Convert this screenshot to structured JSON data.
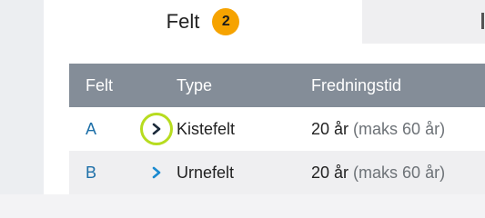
{
  "tabs": [
    {
      "label": "Felt",
      "badge": "2",
      "active": true
    },
    {
      "label": "",
      "active": false
    }
  ],
  "table": {
    "headers": {
      "felt": "Felt",
      "type": "Type",
      "fredningstid": "Fredningstid"
    },
    "rows": [
      {
        "felt": "A",
        "type": "Kistefelt",
        "fredningstid": "20 år",
        "maks": "(maks 60 år)",
        "chevron_icon": "chevron-right-icon",
        "chevron_color": "#1b2a3a",
        "focused": true
      },
      {
        "felt": "B",
        "type": "Urnefelt",
        "fredningstid": "20 år",
        "maks": "(maks 60 år)",
        "chevron_icon": "chevron-right-icon",
        "chevron_color": "#1a8ad0",
        "focused": false
      }
    ]
  },
  "colors": {
    "badge": "#f6a300",
    "header_bg": "#848d98",
    "focus_ring": "#b7dc1f",
    "link": "#1d6fa8"
  }
}
